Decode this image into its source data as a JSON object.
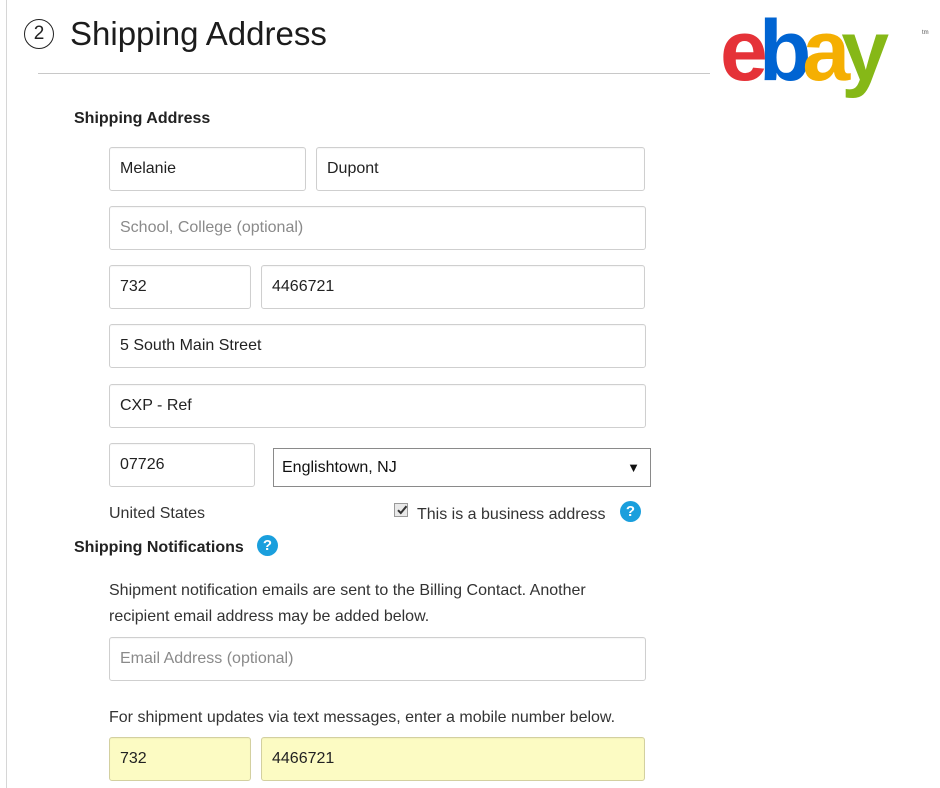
{
  "header": {
    "step_number": "2",
    "title": "Shipping Address"
  },
  "logo": {
    "text": "ebay",
    "tm": "tm",
    "colors": {
      "e": "#e53238",
      "b": "#0064d2",
      "a": "#f5af02",
      "y": "#86b817"
    }
  },
  "shipping_address": {
    "heading": "Shipping Address",
    "first_name": "Melanie",
    "last_name": "Dupont",
    "company_placeholder": "School, College (optional)",
    "phone_area": "732",
    "phone_number": "4466721",
    "address_line1": "5 South Main Street",
    "address_line2": "CXP - Ref",
    "zip": "07726",
    "city_state_selected": "Englishtown, NJ",
    "country": "United States",
    "business_checkbox_label": "This is a business address",
    "business_checked": true
  },
  "notifications": {
    "heading": "Shipping Notifications",
    "email_info": "Shipment notification emails are sent to the Billing Contact. Another",
    "email_info_line2": "recipient email address may be added below.",
    "email_placeholder": "Email Address (optional)",
    "sms_info": "For shipment updates via text messages, enter a mobile number below.",
    "mobile_area": "732",
    "mobile_number": "4466721"
  },
  "icons": {
    "help": "question-mark-icon",
    "dropdown": "dropdown-caret-icon",
    "checkbox": "checkmark-icon"
  },
  "accent_color": "#1a9fdd",
  "highlight_color": "#fcfbc3"
}
